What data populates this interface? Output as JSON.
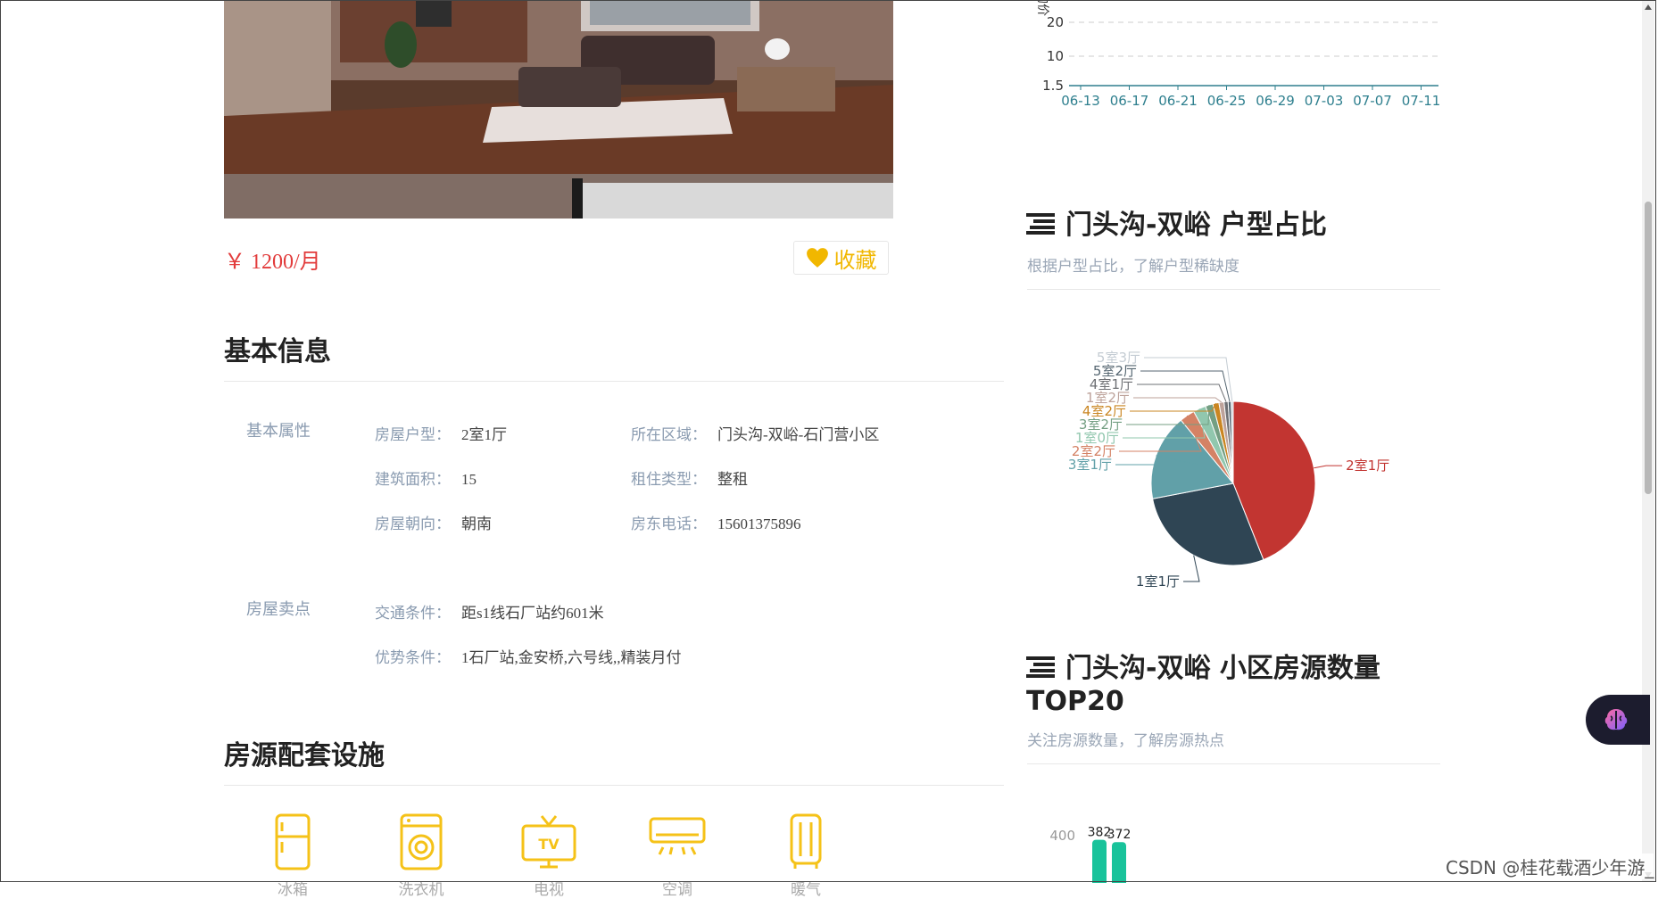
{
  "listing": {
    "price": "￥ 1200/月",
    "favorite_label": "收藏"
  },
  "basic_info": {
    "title": "基本信息",
    "group1_label": "基本属性",
    "group1": [
      {
        "key": "房屋户型：",
        "value": "2室1厅"
      },
      {
        "key": "所在区域：",
        "value": "门头沟-双峪-石门营小区"
      },
      {
        "key": "建筑面积：",
        "value": "15"
      },
      {
        "key": "租住类型：",
        "value": "整租"
      },
      {
        "key": "房屋朝向：",
        "value": "朝南"
      },
      {
        "key": "房东电话：",
        "value": "15601375896"
      }
    ],
    "group2_label": "房屋卖点",
    "group2": [
      {
        "key": "交通条件：",
        "value": "距s1线石厂站约601米"
      },
      {
        "key": "优势条件：",
        "value": "1石厂站,金安桥,六号线,,精装月付"
      }
    ]
  },
  "facilities": {
    "title": "房源配套设施",
    "items": [
      {
        "label": "冰箱",
        "icon": "fridge-icon"
      },
      {
        "label": "洗衣机",
        "icon": "washing-machine-icon"
      },
      {
        "label": "电视",
        "icon": "tv-icon"
      },
      {
        "label": "空调",
        "icon": "air-conditioner-icon"
      },
      {
        "label": "暖气",
        "icon": "heater-icon"
      }
    ]
  },
  "trend_chart": {
    "y_ticks": [
      "20",
      "10",
      "1.5"
    ],
    "y_label_fragment": "均价",
    "x_ticks": [
      "06-13",
      "06-17",
      "06-21",
      "06-25",
      "06-29",
      "07-03",
      "07-07",
      "07-11"
    ]
  },
  "layout_panel": {
    "title": "门头沟-双峪 户型占比",
    "subtitle": "根据户型占比，了解户型稀缺度"
  },
  "top20_panel": {
    "title_line1": "门头沟-双峪 小区房源数量",
    "title_line2": "TOP20",
    "subtitle": "关注房源数量，了解房源热点"
  },
  "chart_data": [
    {
      "type": "pie",
      "title": "门头沟-双峪 户型占比",
      "slices": [
        {
          "name": "2室1厅",
          "value": 44,
          "color": "#c23531"
        },
        {
          "name": "1室1厅",
          "value": 28,
          "color": "#2f4554"
        },
        {
          "name": "3室1厅",
          "value": 17,
          "color": "#61a0a8"
        },
        {
          "name": "2室2厅",
          "value": 3,
          "color": "#d48265"
        },
        {
          "name": "1室0厅",
          "value": 2.5,
          "color": "#91c7ae"
        },
        {
          "name": "3室2厅",
          "value": 1.5,
          "color": "#749f83"
        },
        {
          "name": "4室2厅",
          "value": 1.2,
          "color": "#ca8622"
        },
        {
          "name": "1室2厅",
          "value": 1,
          "color": "#bda29a"
        },
        {
          "name": "4室1厅",
          "value": 0.8,
          "color": "#6e7074"
        },
        {
          "name": "5室2厅",
          "value": 0.6,
          "color": "#546570"
        },
        {
          "name": "5室3厅",
          "value": 0.4,
          "color": "#c4ccd3"
        }
      ]
    },
    {
      "type": "bar",
      "title": "门头沟-双峪 小区房源数量 TOP20",
      "y_tick": "400",
      "values": [
        382,
        372
      ],
      "color": "#19c39b"
    }
  ],
  "watermark": "CSDN @桂花载酒少年游_"
}
